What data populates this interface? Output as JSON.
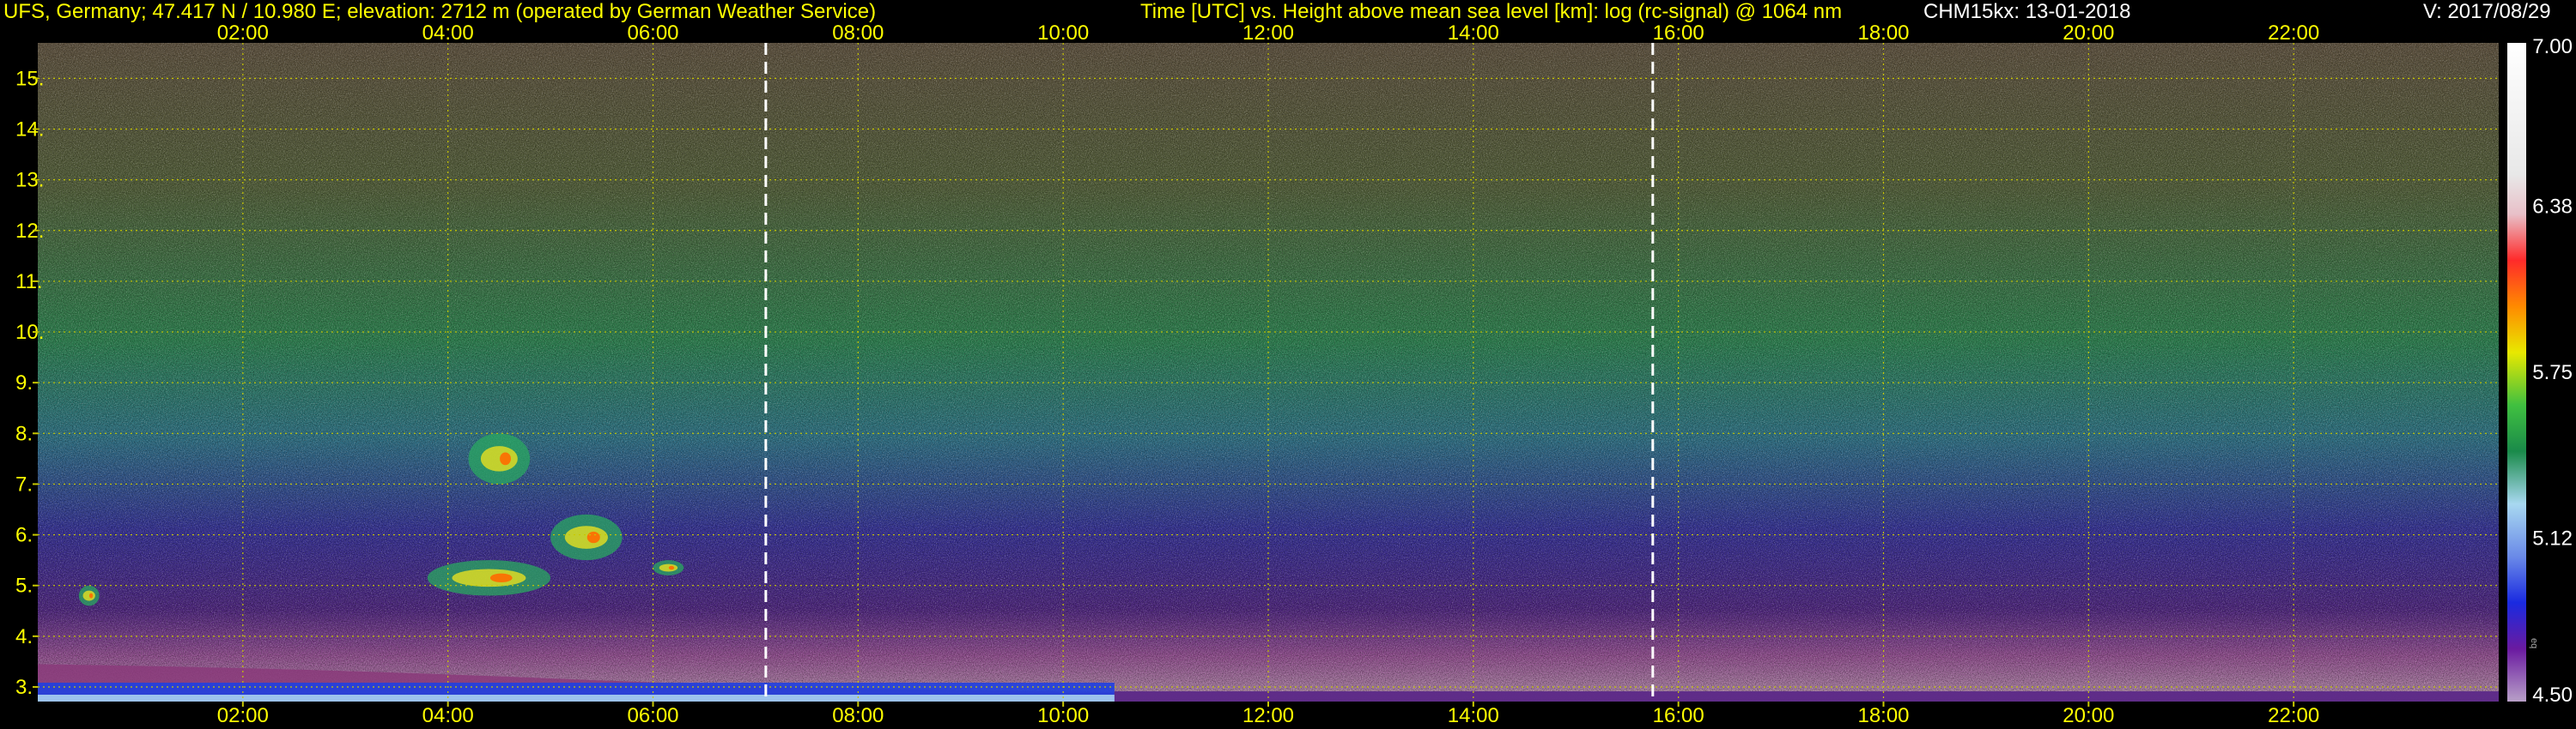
{
  "header": {
    "station": "UFS, Germany; 47.417 N / 10.980 E; elevation: 2712 m  (operated by German Weather Service)",
    "plot_title": "Time [UTC] vs. Height above mean sea level [km]: log (rc-signal) @ 1064 nm",
    "instrument_date": "CHM15kx: 13-01-2018",
    "version": "V: 2017/08/29"
  },
  "colors": {
    "text": "#ffff00",
    "grid": "#c8c800",
    "marker_lines": "#ffffff",
    "background": "#000000"
  },
  "chart_data": {
    "type": "heatmap",
    "title": "Time [UTC] vs. Height above mean sea level [km]: log (rc-signal) @ 1064 nm",
    "x_ticks": [
      "02:00",
      "04:00",
      "06:00",
      "08:00",
      "10:00",
      "12:00",
      "14:00",
      "16:00",
      "18:00",
      "20:00",
      "22:00"
    ],
    "x_tick_hours": [
      2,
      4,
      6,
      8,
      10,
      12,
      14,
      16,
      18,
      20,
      22
    ],
    "xlim_hours": [
      0,
      24
    ],
    "y_ticks": [
      "3.",
      "4.",
      "5.",
      "6.",
      "7.",
      "8.",
      "9.",
      "10.",
      "11.",
      "12.",
      "13.",
      "14.",
      "15."
    ],
    "y_tick_values": [
      3,
      4,
      5,
      6,
      7,
      8,
      9,
      10,
      11,
      12,
      13,
      14,
      15
    ],
    "ylim_km": [
      2.712,
      15.7
    ],
    "grid": true,
    "vertical_markers_hours": [
      7.1,
      15.75
    ],
    "colorbar": {
      "labels": [
        "7.00",
        "6.38",
        "5.75",
        "5.12",
        "4.50"
      ],
      "values": [
        7.0,
        6.38,
        5.75,
        5.12,
        4.5
      ],
      "range": [
        4.5,
        7.0
      ],
      "small_label": "eq"
    },
    "features": [
      {
        "name": "boundary layer",
        "t_start": 0,
        "t_end": 10.5,
        "h_top_start": 3.45,
        "h_top_end": 2.9
      },
      {
        "name": "cloud",
        "t_start": 3.8,
        "t_end": 5.0,
        "h_min": 4.8,
        "h_max": 5.5
      },
      {
        "name": "cloud",
        "t_start": 4.2,
        "t_end": 4.8,
        "h_min": 7.0,
        "h_max": 8.0
      },
      {
        "name": "cloud",
        "t_start": 5.0,
        "t_end": 5.7,
        "h_min": 5.5,
        "h_max": 6.4
      },
      {
        "name": "cloud",
        "t_start": 6.0,
        "t_end": 6.3,
        "h_min": 5.2,
        "h_max": 5.5
      },
      {
        "name": "cloud",
        "t_start": 0.4,
        "t_end": 0.6,
        "h_min": 4.6,
        "h_max": 5.0
      }
    ]
  }
}
